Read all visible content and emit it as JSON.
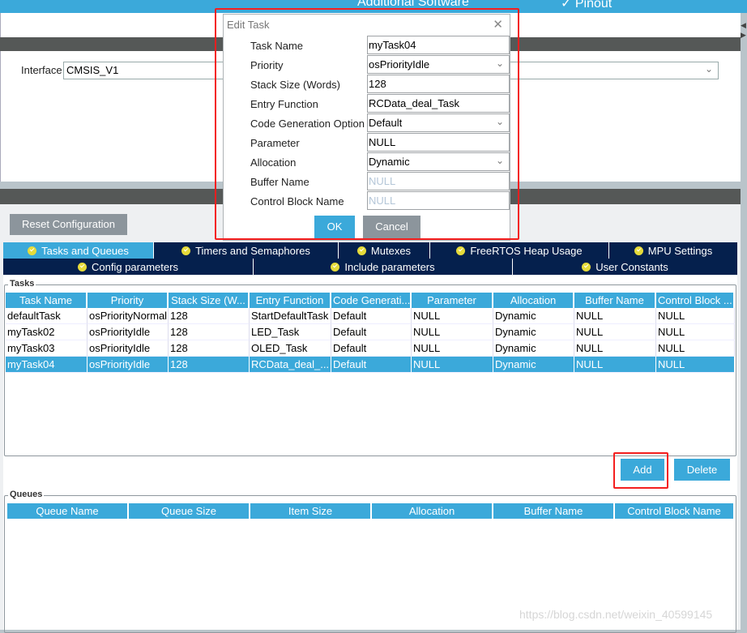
{
  "topbar": {
    "additional_software": "Additional Software",
    "pinout": "Pinout",
    "pinout_icon": "chevron-down-icon"
  },
  "interface": {
    "label": "Interface",
    "value": "CMSIS_V1"
  },
  "reset_button": "Reset Configuration",
  "tabs_row1": [
    {
      "label": "Tasks and Queues",
      "active": true
    },
    {
      "label": "Timers and Semaphores",
      "active": false
    },
    {
      "label": "Mutexes",
      "active": false
    },
    {
      "label": "FreeRTOS Heap Usage",
      "active": false
    },
    {
      "label": "MPU Settings",
      "active": false
    }
  ],
  "tabs_row2": [
    {
      "label": "Config parameters"
    },
    {
      "label": "Include parameters"
    },
    {
      "label": "User Constants"
    }
  ],
  "tasks": {
    "legend": "Tasks",
    "columns": [
      "Task Name",
      "Priority",
      "Stack Size (W...",
      "Entry Function",
      "Code Generati...",
      "Parameter",
      "Allocation",
      "Buffer Name",
      "Control Block ..."
    ],
    "rows": [
      [
        "defaultTask",
        "osPriorityNormal",
        "128",
        "StartDefaultTask",
        "Default",
        "NULL",
        "Dynamic",
        "NULL",
        "NULL"
      ],
      [
        "myTask02",
        "osPriorityIdle",
        "128",
        "LED_Task",
        "Default",
        "NULL",
        "Dynamic",
        "NULL",
        "NULL"
      ],
      [
        "myTask03",
        "osPriorityIdle",
        "128",
        "OLED_Task",
        "Default",
        "NULL",
        "Dynamic",
        "NULL",
        "NULL"
      ],
      [
        "myTask04",
        "osPriorityIdle",
        "128",
        "RCData_deal_...",
        "Default",
        "NULL",
        "Dynamic",
        "NULL",
        "NULL"
      ]
    ],
    "selected_row": 3,
    "add_label": "Add",
    "delete_label": "Delete"
  },
  "queues": {
    "legend": "Queues",
    "columns": [
      "Queue Name",
      "Queue Size",
      "Item Size",
      "Allocation",
      "Buffer Name",
      "Control Block Name"
    ],
    "rows": []
  },
  "dialog": {
    "title": "Edit Task",
    "close_icon": "close-icon",
    "fields": [
      {
        "label": "Task Name",
        "value": "myTask04",
        "type": "text"
      },
      {
        "label": "Priority",
        "value": "osPriorityIdle",
        "type": "select"
      },
      {
        "label": "Stack Size (Words)",
        "value": "128",
        "type": "text"
      },
      {
        "label": "Entry Function",
        "value": "RCData_deal_Task",
        "type": "text"
      },
      {
        "label": "Code Generation Option",
        "value": "Default",
        "type": "select"
      },
      {
        "label": "Parameter",
        "value": "NULL",
        "type": "text"
      },
      {
        "label": "Allocation",
        "value": "Dynamic",
        "type": "select"
      },
      {
        "label": "Buffer Name",
        "value": "NULL",
        "type": "text",
        "disabled": true
      },
      {
        "label": "Control Block Name",
        "value": "NULL",
        "type": "text",
        "disabled": true
      }
    ],
    "ok_label": "OK",
    "cancel_label": "Cancel"
  },
  "colors": {
    "accent": "#3ba9da",
    "tab_dark": "#05204d",
    "highlight": "#f41f1f",
    "button_gray": "#8c959c"
  },
  "watermark": "https://blog.csdn.net/weixin_40599145"
}
